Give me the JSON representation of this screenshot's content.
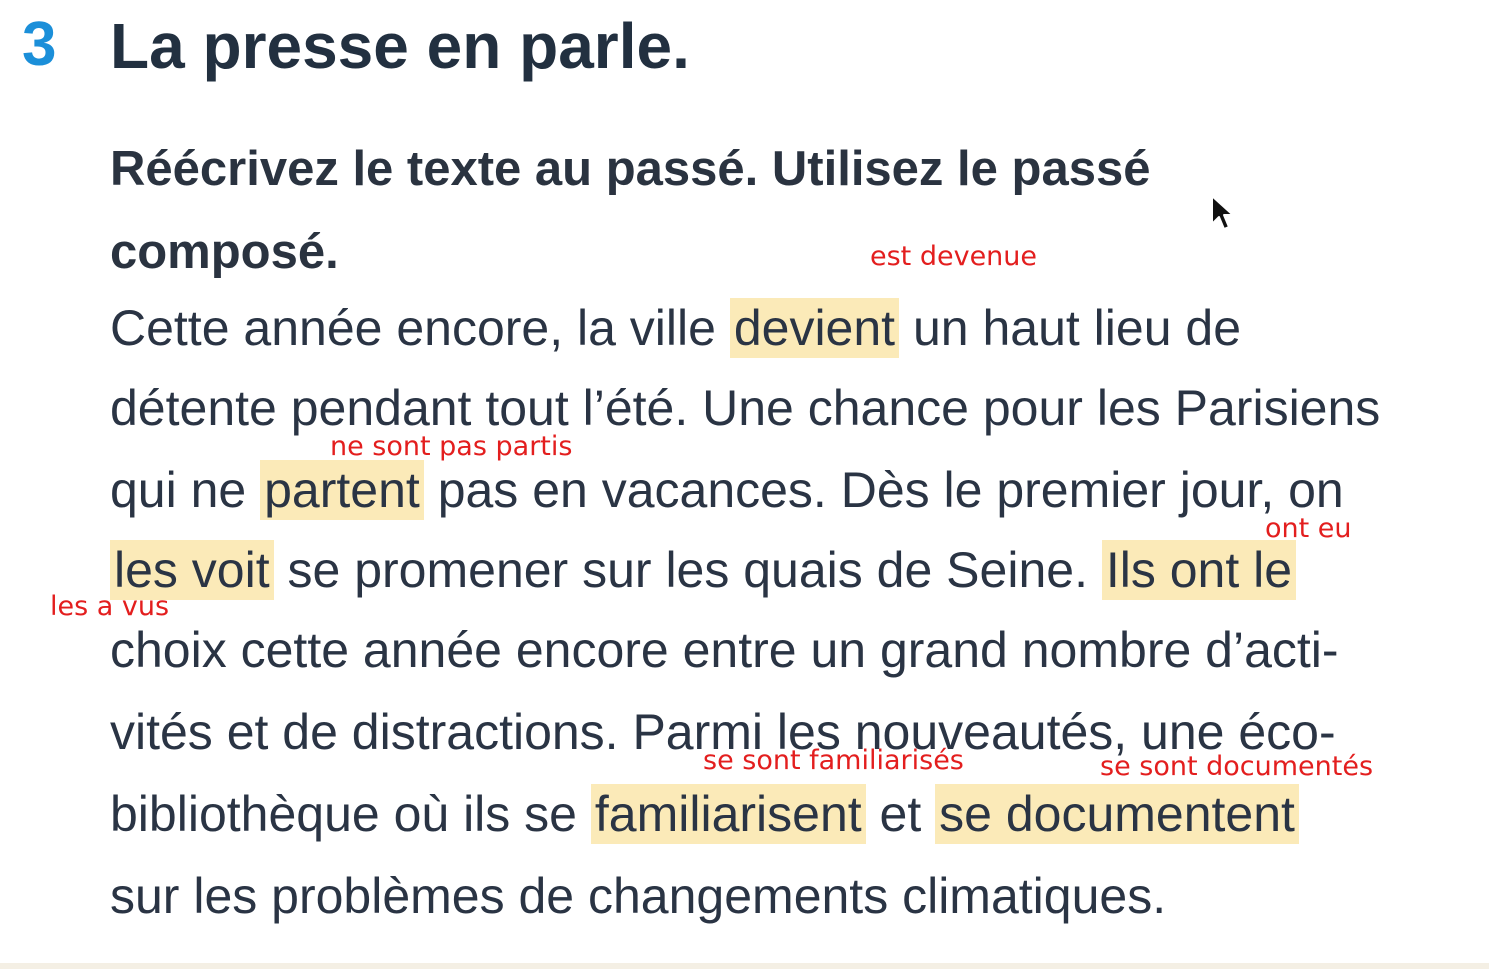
{
  "exercise": {
    "number": "3",
    "title": "La presse en parle.",
    "instruction": "Réécrivez le texte au passé. Utilisez le passé composé."
  },
  "text_lines": [
    {
      "before": "Cette année encore, la ville ",
      "highlight": "devient",
      "after": " un haut lieu de"
    },
    {
      "text": "détente pendant tout l’été. Une chance pour les Parisiens"
    },
    {
      "before": "qui ne ",
      "highlight": "partent",
      "after": " pas en vacances. Dès le premier jour, on"
    },
    {
      "highlight": "les voit",
      "middle": " se promener sur les quais de Seine. ",
      "highlight2": "Ils ont le"
    },
    {
      "text": "choix cette année encore entre un grand nombre d’acti-"
    },
    {
      "text": "vités et de distractions. Parmi les nouveautés, une éco-"
    },
    {
      "before": "bibliothèque où ils se ",
      "highlight": "familiarisent",
      "middle": " et ",
      "highlight2": "se documentent"
    },
    {
      "text": "sur les problèmes de changements climatiques."
    }
  ],
  "annotations": {
    "devient": "est devenue",
    "partent": "ne sont pas partis",
    "ont_le": "ont eu",
    "voit": "les a vus",
    "familiarisent": "se sont familiarisés",
    "documentent": "se sont documentés"
  },
  "colors": {
    "exercise_number": "#1b8fd9",
    "highlight": "#fbeab8",
    "annotation": "#e31e1e"
  }
}
